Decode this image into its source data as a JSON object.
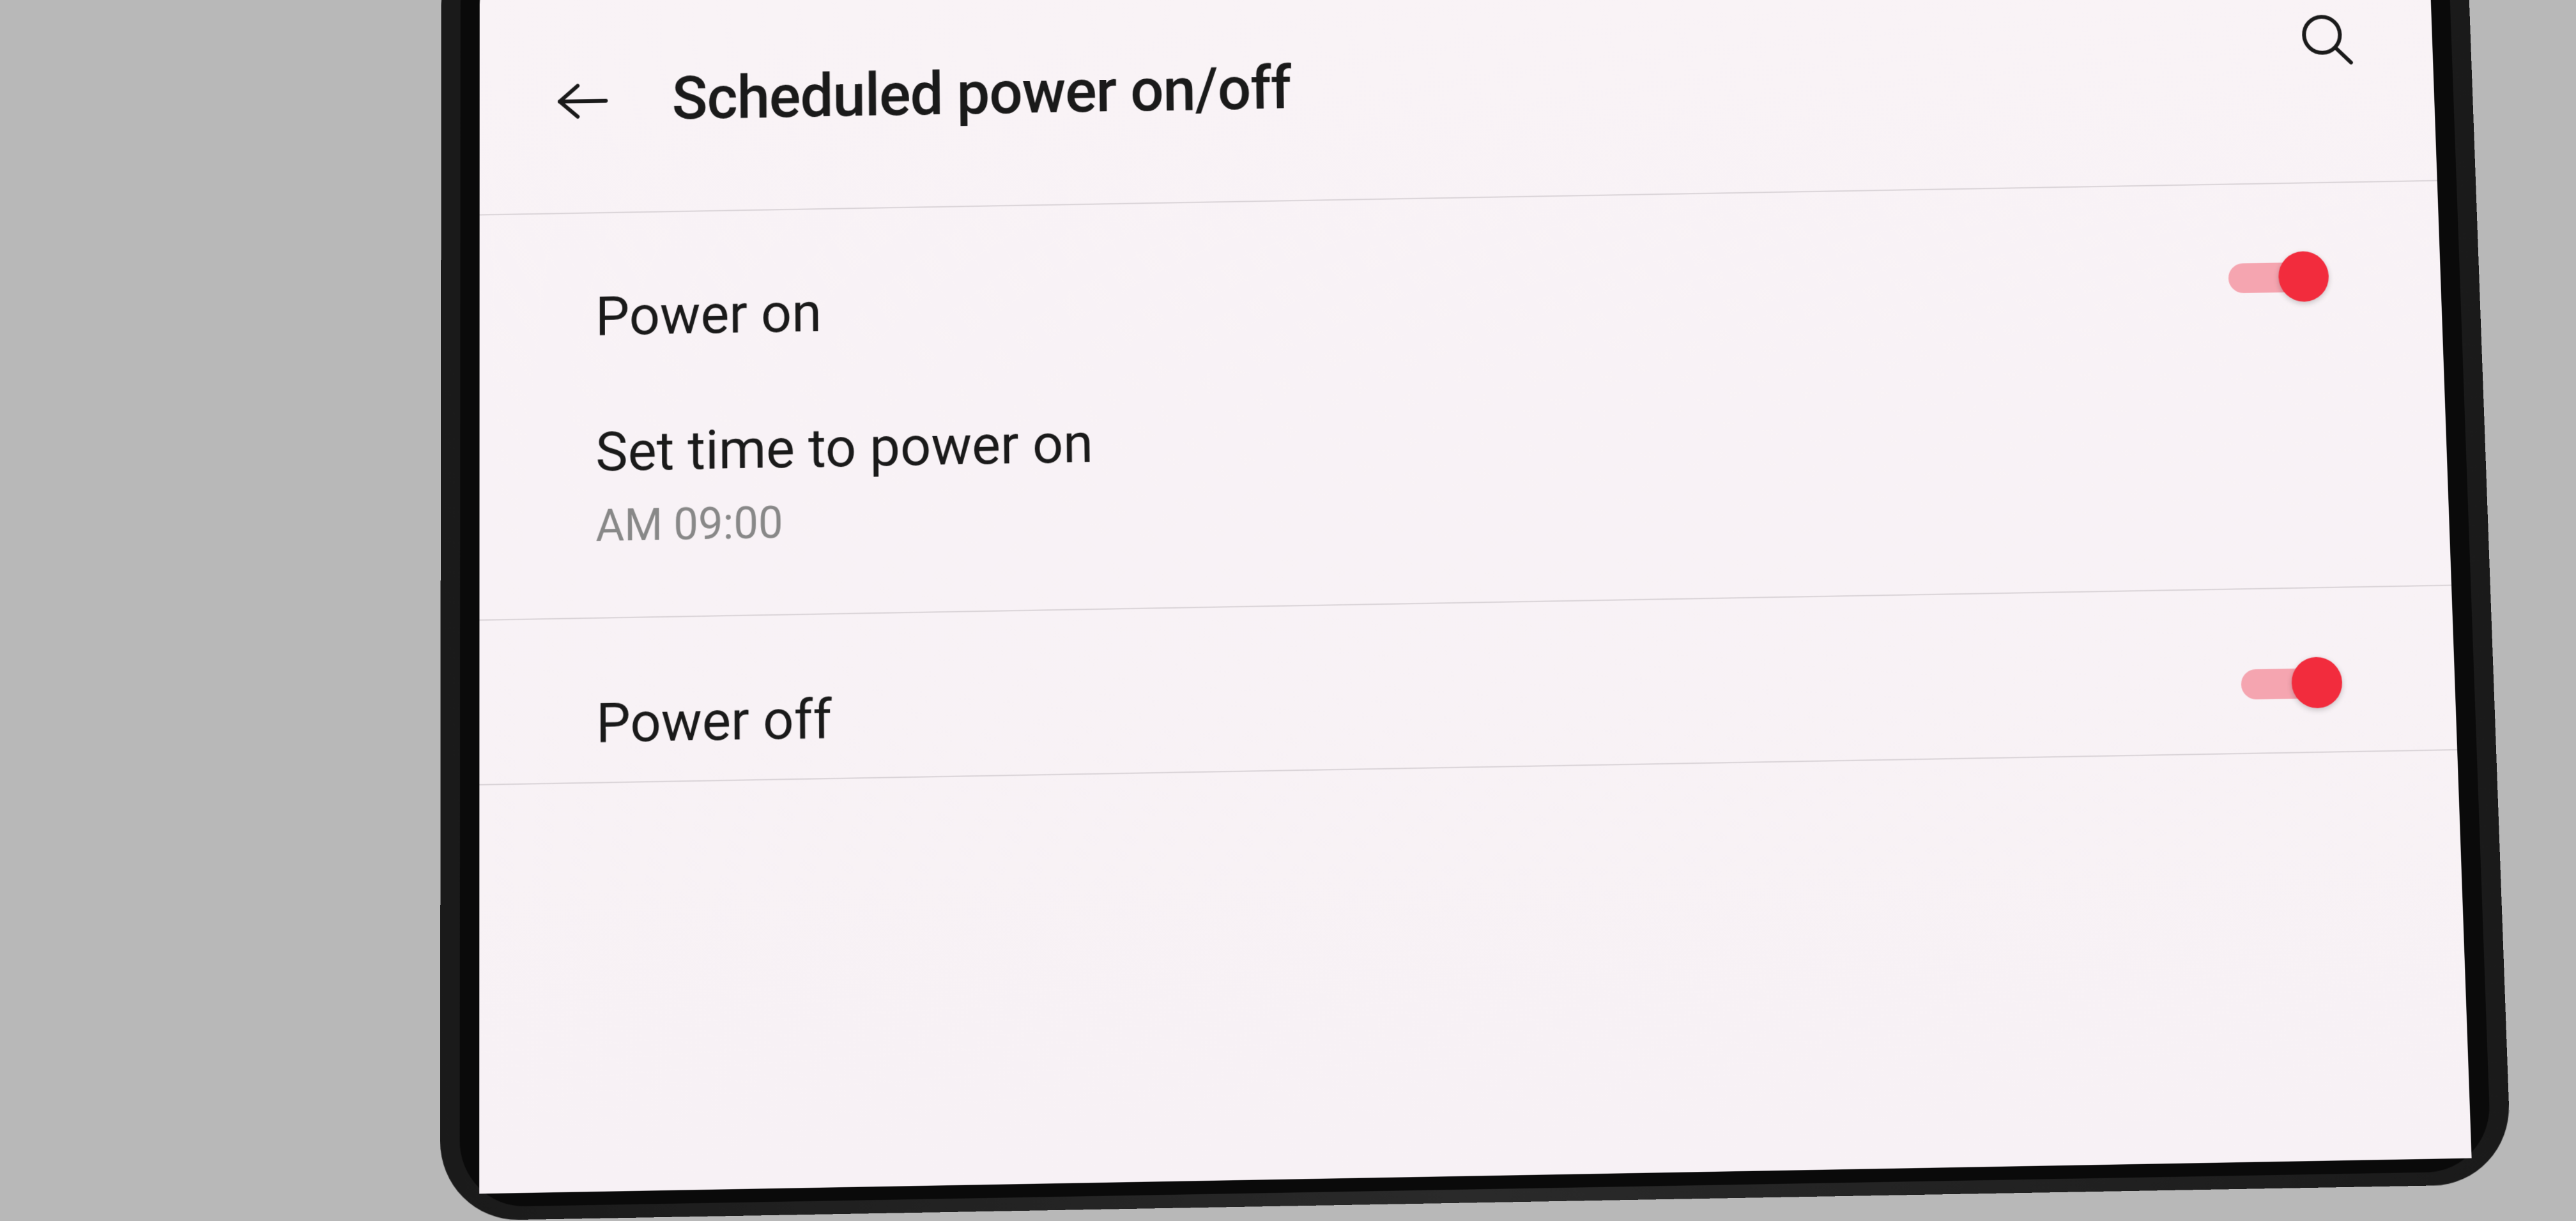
{
  "header": {
    "title": "Scheduled power on/off"
  },
  "sections": {
    "power_on": {
      "toggle_label": "Power on",
      "time_label": "Set time to power on",
      "time_value": "AM 09:00",
      "enabled": true
    },
    "power_off": {
      "toggle_label": "Power off",
      "enabled": true
    }
  }
}
